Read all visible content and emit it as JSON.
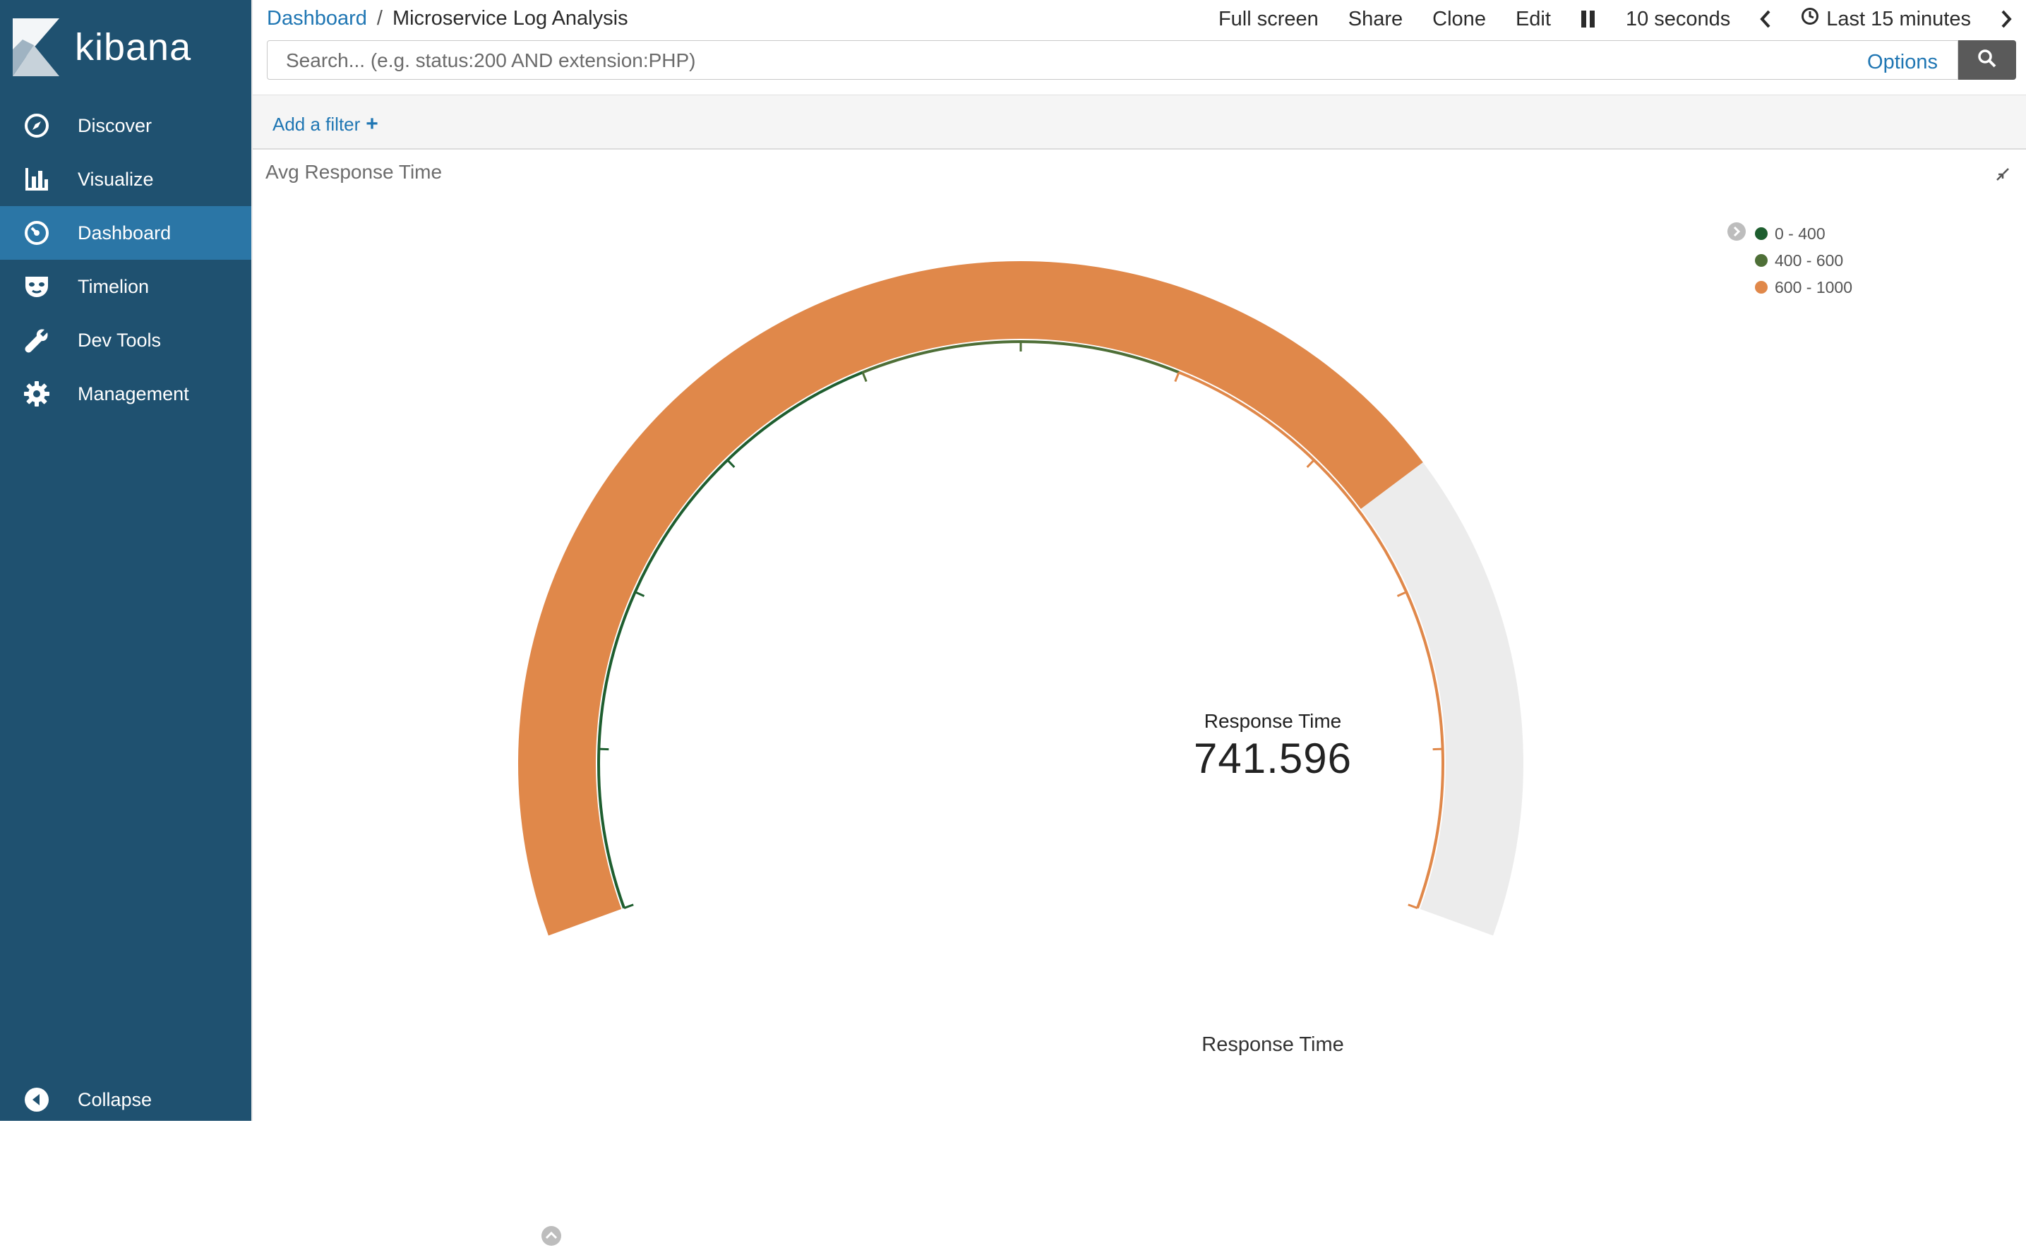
{
  "app": {
    "logo_text": "kibana"
  },
  "sidebar": {
    "items": [
      {
        "label": "Discover",
        "icon": "compass-icon"
      },
      {
        "label": "Visualize",
        "icon": "bar-chart-icon"
      },
      {
        "label": "Dashboard",
        "icon": "dashboard-icon",
        "active": true
      },
      {
        "label": "Timelion",
        "icon": "timelion-mask-icon"
      },
      {
        "label": "Dev Tools",
        "icon": "wrench-icon"
      },
      {
        "label": "Management",
        "icon": "gear-icon"
      }
    ],
    "collapse_label": "Collapse"
  },
  "header": {
    "breadcrumb": {
      "link": "Dashboard",
      "separator": "/",
      "current": "Microservice Log Analysis"
    },
    "menu": {
      "full_screen": "Full screen",
      "share": "Share",
      "clone": "Clone",
      "edit": "Edit",
      "refresh_interval": "10 seconds",
      "time_range": "Last 15 minutes"
    }
  },
  "search": {
    "placeholder": "Search... (e.g. status:200 AND extension:PHP)",
    "value": "",
    "options_label": "Options"
  },
  "filters": {
    "add_filter_label": "Add a filter",
    "add_icon": "+"
  },
  "panel": {
    "title": "Avg Response Time",
    "gauge": {
      "metric_label": "Response Time",
      "value_text": "741.596",
      "value": 741.596,
      "min": 0,
      "max": 1000,
      "bottom_label": "Response Time",
      "ranges": [
        {
          "label": "0 - 400",
          "from": 0,
          "to": 400,
          "color": "#1e5e2f"
        },
        {
          "label": "400 - 600",
          "from": 400,
          "to": 600,
          "color": "#4e6f37"
        },
        {
          "label": "600 - 1000",
          "from": 600,
          "to": 1000,
          "color": "#e0884a"
        }
      ],
      "fill_color": "#e0884a",
      "track_color": "#ececec"
    }
  },
  "colors": {
    "sidebar_bg": "#1f5170",
    "sidebar_active": "#2b76a6",
    "link": "#1f76b3"
  }
}
